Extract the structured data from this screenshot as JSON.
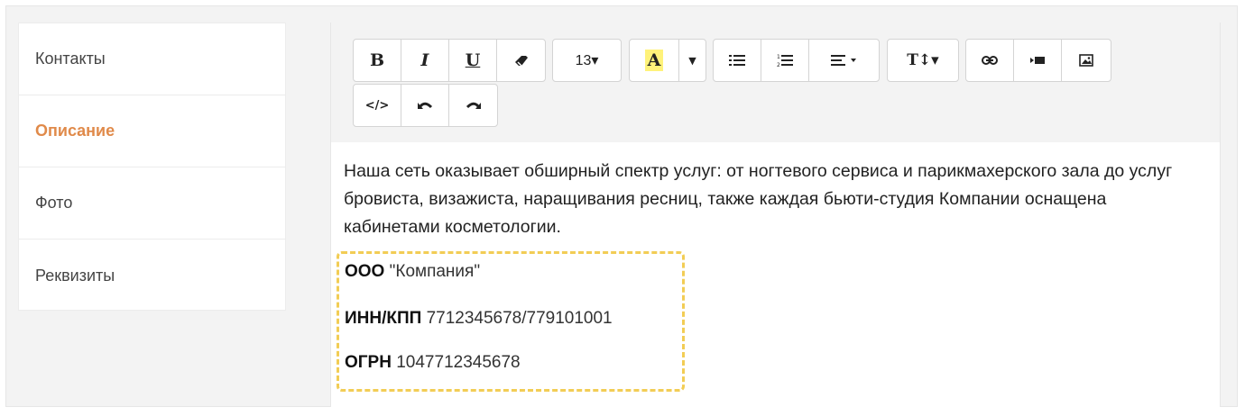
{
  "sidebar": {
    "items": [
      {
        "label": "Контакты"
      },
      {
        "label": "Описание"
      },
      {
        "label": "Фото"
      },
      {
        "label": "Реквизиты"
      }
    ]
  },
  "toolbar": {
    "bold": "B",
    "italic": "I",
    "underline": "U",
    "font_size": "13▾",
    "text_color": "A",
    "text_style": "T↕▾",
    "code": "</>",
    "highlight_color": "#fff27a"
  },
  "content": {
    "paragraph": "Наша сеть оказывает обширный спектр услуг: от ногтевого сервиса и парикмахерского зала до услуг бровиста, визажиста, наращивания ресниц, также каждая бьюти-студия Компании оснащена кабинетами косметологии.",
    "company_label": "ООО",
    "company_value": "\"Компания\"",
    "inn_label": "ИНН/КПП",
    "inn_value": "7712345678/779101001",
    "ogrn_label": "ОГРН",
    "ogrn_value": "1047712345678"
  },
  "colors": {
    "accent": "#e08a4a",
    "dash": "#f2cd55"
  }
}
